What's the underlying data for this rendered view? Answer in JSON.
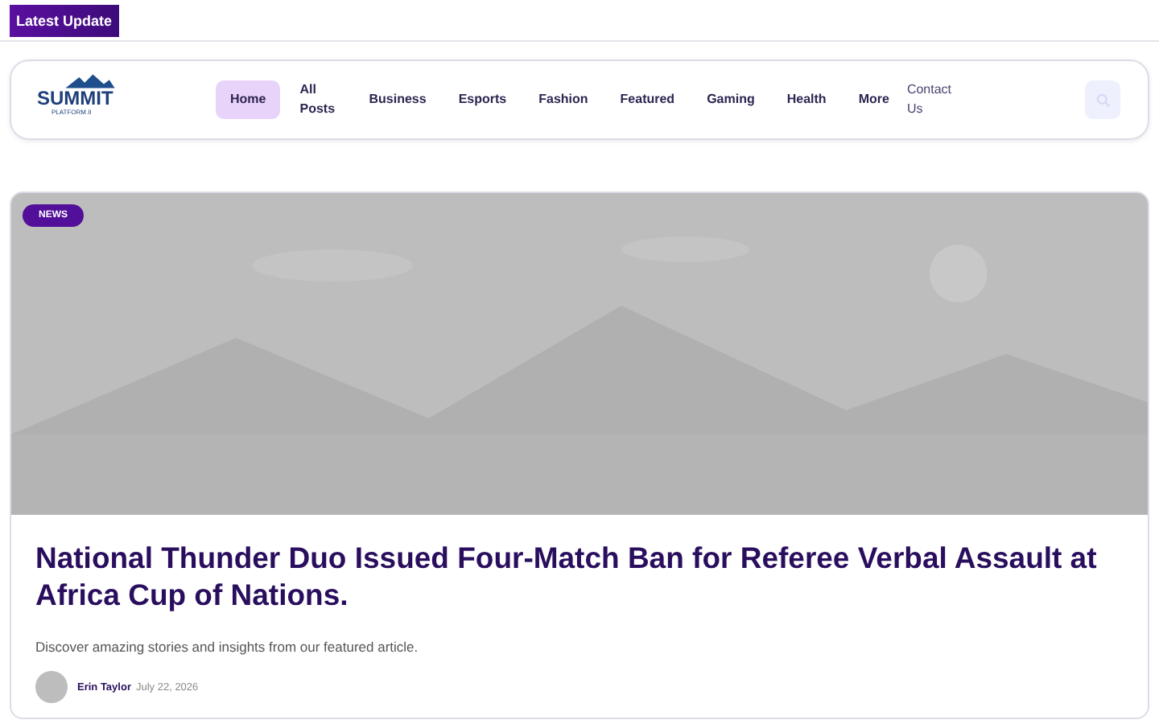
{
  "top_bar": {
    "badge": "Latest Update"
  },
  "header": {
    "logo": {
      "name": "SUMMIT",
      "tagline": "PLATFORM.II"
    },
    "nav": [
      {
        "label": "Home",
        "selected": true,
        "kind": "menu"
      },
      {
        "label": "All Posts",
        "selected": false,
        "kind": "menu"
      },
      {
        "label": "Business",
        "selected": false,
        "kind": "menu"
      },
      {
        "label": "Esports",
        "selected": false,
        "kind": "menu"
      },
      {
        "label": "Fashion",
        "selected": false,
        "kind": "menu"
      },
      {
        "label": "Featured",
        "selected": false,
        "kind": "menu"
      },
      {
        "label": "Gaming",
        "selected": false,
        "kind": "menu"
      },
      {
        "label": "Health",
        "selected": false,
        "kind": "menu"
      },
      {
        "label": "More",
        "selected": false,
        "kind": "menu"
      },
      {
        "label": "Contact Us",
        "selected": false,
        "kind": "page"
      }
    ]
  },
  "featured": {
    "tag": "NEWS",
    "title": "National Thunder Duo Issued Four-Match Ban for Referee Verbal Assault at Africa Cup of Nations.",
    "description": "Discover amazing stories and insights from our featured article.",
    "author": "Erin Taylor",
    "date": "July 22, 2026"
  }
}
